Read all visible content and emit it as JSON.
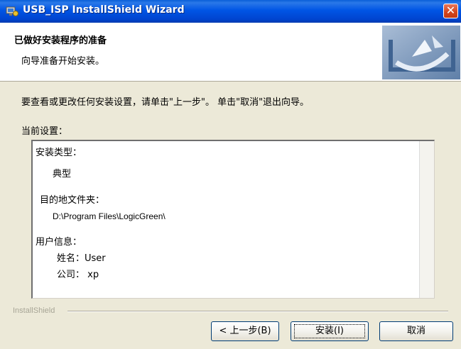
{
  "window": {
    "title": "USB_ISP InstallShield Wizard",
    "close_symbol": "✕",
    "colors": {
      "titlebar": "#0055e5",
      "close": "#d2441c",
      "dialog": "#ece9d8"
    }
  },
  "header": {
    "title": "已做好安装程序的准备",
    "subtitle": "向导准备开始安装。"
  },
  "body": {
    "instruction": "要查看或更改任何安装设置，请单击\"上一步\"。 单击\"取消\"退出向导。",
    "settings_label": "当前设置：",
    "settings": {
      "setup_type_label": "安装类型：",
      "setup_type_value": "典型",
      "dest_folder_label": "目的地文件夹：",
      "dest_folder_value": "D:\\Program Files\\LogicGreen\\",
      "user_info_label": "用户信息：",
      "name_line": "姓名：User",
      "company_line": "公司： xp"
    }
  },
  "footer": {
    "brand": "InstallShield",
    "back_button": "< 上一步(B)",
    "install_button": "安装(I)",
    "cancel_button": "取消"
  }
}
